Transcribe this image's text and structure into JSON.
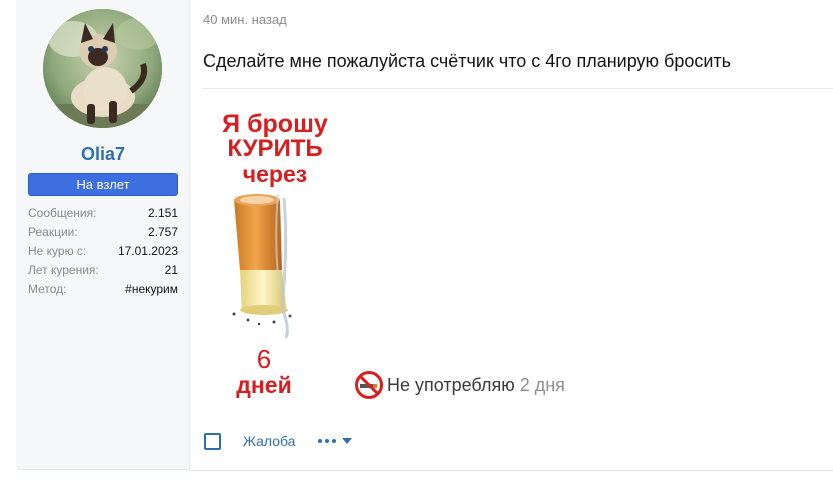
{
  "user": {
    "name": "Olia7",
    "title": "На взлет",
    "stats": [
      {
        "label": "Сообщения:",
        "value": "2.151"
      },
      {
        "label": "Реакции:",
        "value": "2.757"
      },
      {
        "label": "Не курю с:",
        "value": "17.01.2023"
      },
      {
        "label": "Лет курения:",
        "value": "21"
      },
      {
        "label": "Метод:",
        "value": "#некурим"
      }
    ]
  },
  "post": {
    "timestamp": "40 мин. назад",
    "text": "Сделайте мне пожалуйста счётчик что с 4го планирую бросить"
  },
  "banner": {
    "line1": "Я брошу",
    "line2": "КУРИТЬ",
    "line3": "через",
    "count": "6",
    "unit": "дней"
  },
  "signature": {
    "text": "Не употребляю",
    "days": "2 дня"
  },
  "actions": {
    "report_label": "Жалоба",
    "more_icon": "ellipsis-icon",
    "link_color": "#2f6fae"
  },
  "colors": {
    "title_badge": "#3d6fe1",
    "banner_red": "#d81e1e"
  }
}
